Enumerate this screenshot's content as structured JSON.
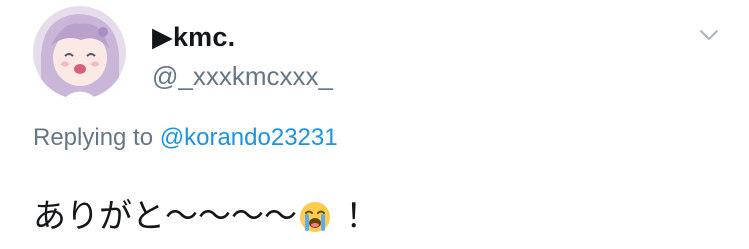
{
  "tweet": {
    "author": {
      "display_name": "▶kmc.",
      "handle": "@_xxxkmcxxx_"
    },
    "menu_icon": "chevron-down-icon",
    "reply": {
      "prefix": "Replying to",
      "mention": "@korando23231"
    },
    "text_before_emoji": "ありがと〜〜〜〜",
    "emoji": "loudly-crying-face-icon",
    "text_after_emoji": " ！"
  },
  "colors": {
    "text": "#14171a",
    "secondary": "#657786",
    "link": "#1b95e0"
  }
}
